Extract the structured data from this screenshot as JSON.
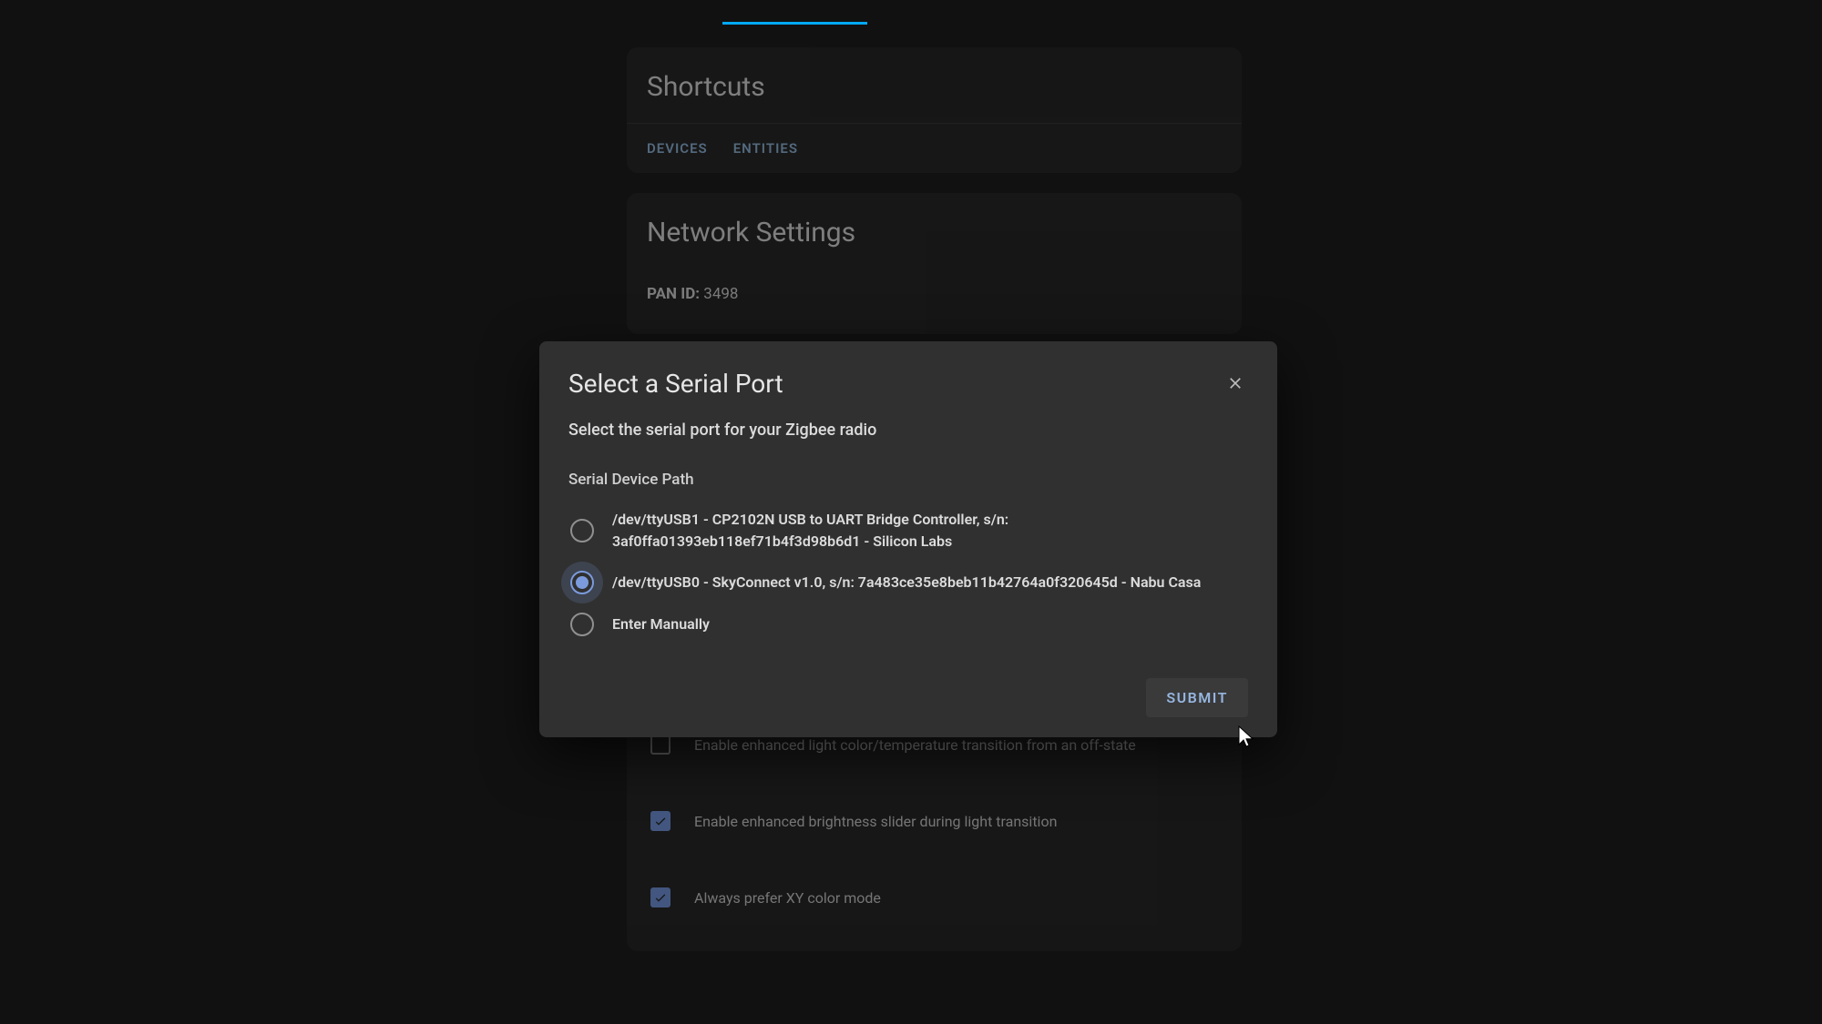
{
  "background": {
    "shortcuts": {
      "title": "Shortcuts",
      "links": {
        "devices": "DEVICES",
        "entities": "ENTITIES"
      }
    },
    "network": {
      "title": "Network Settings",
      "pan_id": {
        "label": "PAN ID:",
        "value": "3498"
      }
    },
    "options": {
      "light_transition": {
        "label": "Enable enhanced light color/temperature transition from an off-state",
        "checked": false
      },
      "brightness_slider": {
        "label": "Enable enhanced brightness slider during light transition",
        "checked": true
      },
      "xy_color": {
        "label": "Always prefer XY color mode",
        "checked": true
      }
    }
  },
  "modal": {
    "title": "Select a Serial Port",
    "subtitle": "Select the serial port for your Zigbee radio",
    "field_label": "Serial Device Path",
    "options": [
      {
        "label": "/dev/ttyUSB1 - CP2102N USB to UART Bridge Controller, s/n: 3af0ffa01393eb118ef71b4f3d98b6d1 - Silicon Labs",
        "selected": false
      },
      {
        "label": "/dev/ttyUSB0 - SkyConnect v1.0, s/n: 7a483ce35e8beb11b42764a0f320645d - Nabu Casa",
        "selected": true
      },
      {
        "label": "Enter Manually",
        "selected": false
      }
    ],
    "submit_label": "SUBMIT"
  }
}
